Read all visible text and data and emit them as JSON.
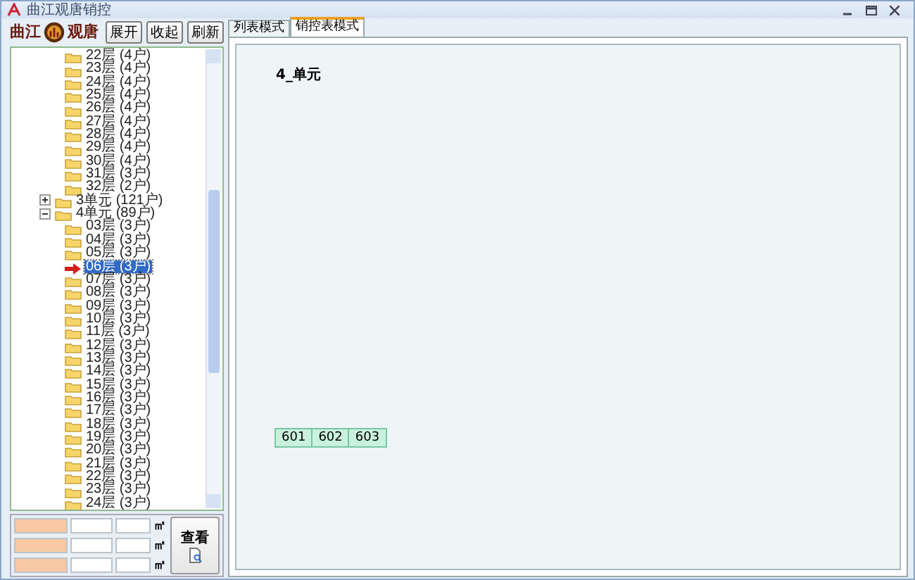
{
  "window": {
    "title": "曲江观唐销控"
  },
  "logo": {
    "left": "曲江",
    "right": "观唐"
  },
  "toolbar": [
    "展开",
    "收起",
    "刷新"
  ],
  "tree": {
    "items": [
      {
        "children": [
          {
            "label": "22层 (4户)",
            "selected": false
          },
          {
            "label": "23层 (4户)",
            "selected": false
          },
          {
            "label": "24层 (4户)",
            "selected": false
          },
          {
            "label": "25层 (4户)",
            "selected": false
          },
          {
            "label": "26层 (4户)",
            "selected": false
          },
          {
            "label": "27层 (4户)",
            "selected": false
          },
          {
            "label": "28层 (4户)",
            "selected": false
          },
          {
            "label": "29层 (4户)",
            "selected": false
          },
          {
            "label": "30层 (4户)",
            "selected": false
          },
          {
            "label": "31层 (3户)",
            "selected": false
          },
          {
            "label": "32层 (2户)",
            "selected": false
          }
        ]
      },
      {
        "label": "3单元 (121户)",
        "expanded": false
      },
      {
        "label": "4单元 (89户)",
        "expanded": true,
        "children": [
          {
            "label": "03层 (3户)",
            "selected": false
          },
          {
            "label": "04层 (3户)",
            "selected": false
          },
          {
            "label": "05层 (3户)",
            "selected": false
          },
          {
            "label": "06层 (3户)",
            "selected": true
          },
          {
            "label": "07层 (3户)",
            "selected": false
          },
          {
            "label": "08层 (3户)",
            "selected": false
          },
          {
            "label": "09层 (3户)",
            "selected": false
          },
          {
            "label": "10层 (3户)",
            "selected": false
          },
          {
            "label": "11层 (3户)",
            "selected": false
          },
          {
            "label": "12层 (3户)",
            "selected": false
          },
          {
            "label": "13层 (3户)",
            "selected": false
          },
          {
            "label": "14层 (3户)",
            "selected": false
          },
          {
            "label": "15层 (3户)",
            "selected": false
          },
          {
            "label": "16层 (3户)",
            "selected": false
          },
          {
            "label": "17层 (3户)",
            "selected": false
          },
          {
            "label": "18层 (3户)",
            "selected": false
          },
          {
            "label": "19层 (3户)",
            "selected": false
          },
          {
            "label": "20层 (3户)",
            "selected": false
          },
          {
            "label": "21层 (3户)",
            "selected": false
          },
          {
            "label": "22层 (3户)",
            "selected": false
          },
          {
            "label": "23层 (3户)",
            "selected": false
          },
          {
            "label": "24层 (3户)",
            "selected": false
          }
        ]
      }
    ]
  },
  "filter": {
    "rows": [
      {
        "unit": "㎡"
      },
      {
        "unit": "㎡"
      },
      {
        "unit": "㎡"
      }
    ],
    "button": "查看"
  },
  "tabs": [
    {
      "label": "列表模式",
      "selected": false
    },
    {
      "label": "销控表模式",
      "selected": true
    }
  ],
  "sales_table": {
    "title": "4_单元",
    "rooms": [
      "601",
      "602",
      "603"
    ]
  }
}
